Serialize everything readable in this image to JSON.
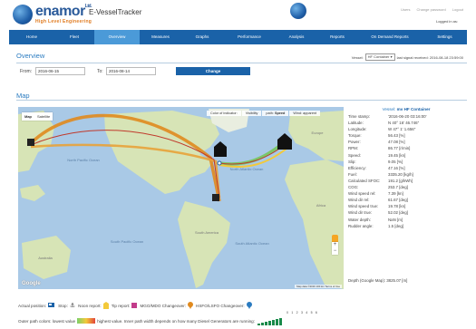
{
  "header": {
    "logo_name": "enamor",
    "logo_sup": "Ltd.",
    "logo_tagline": "High Level Engineering",
    "app_title": "E-VesselTracker",
    "top_links": [
      "Users",
      "Change password",
      "Logout"
    ],
    "logged_in": "Logged in as:"
  },
  "nav": {
    "items": [
      "Home",
      "Fleet",
      "Overview",
      "Measures",
      "Graphs",
      "Performance",
      "Analysis",
      "Reports",
      "On Demand Reports",
      "Settings"
    ],
    "active": "Overview"
  },
  "overview": {
    "title": "Overview",
    "vessel_label": "Vessel:",
    "vessel_value": "HF Container",
    "last_signal": "last signal received: 2016-08-18 23:59:00",
    "from_label": "From:",
    "from_value": "2016-06-15",
    "to_label": "To:",
    "to_value": "2016-08-14",
    "change_button": "Change"
  },
  "map": {
    "title": "Map",
    "tabs": [
      "Map",
      "Satellite"
    ],
    "active_tab": "Map",
    "overlay_options": [
      "Color of indicator:",
      "Visibility",
      "path:",
      "Speed",
      "Wind: apparent"
    ],
    "google_logo": "Google",
    "attribution": "Map data ©2016   100 km   Terms of Use",
    "labels": [
      "North Pacific Ocean",
      "North Atlantic Ocean",
      "South Pacific Ocean",
      "South Atlantic Ocean",
      "Australia",
      "Africa",
      "South America",
      "Europe"
    ]
  },
  "vessel_info": {
    "title_prefix": "Vessel:",
    "title_name": "mv HF Container",
    "rows": [
      {
        "k": "Time stamp:",
        "v": "'2016-06-20 03:16:00'"
      },
      {
        "k": "Latitude:",
        "v": "N 40° 16' 46.746\""
      },
      {
        "k": "Longitude:",
        "v": "W 47° 1' 1.656\""
      },
      {
        "k": "Torque:",
        "v": "56.43 [%]"
      },
      {
        "k": "Power:",
        "v": "47.08 [%]"
      },
      {
        "k": "RPM:",
        "v": "86.77 [r/min]"
      },
      {
        "k": "Speed:",
        "v": "19.45 [kn]"
      },
      {
        "k": "Slip:",
        "v": "9.05 [%]"
      },
      {
        "k": "Efficiency:",
        "v": "47.16 [%]"
      },
      {
        "k": "Fuel:",
        "v": "3335.20 [kg/h]"
      },
      {
        "k": "Calculated SFOC:",
        "v": "191.2 [g/kWh]"
      },
      {
        "k": "COG:",
        "v": "253.7 [deg]"
      },
      {
        "k": "Wind speed rel:",
        "v": "7.39 [kn]"
      },
      {
        "k": "Wind dir rel:",
        "v": "61.67 [deg]"
      },
      {
        "k": "Wind speed true:",
        "v": "19.78 [kn]"
      },
      {
        "k": "Wind dir true:",
        "v": "52.02 [deg]"
      },
      {
        "k": "Water depth:",
        "v": "NaN [m]"
      },
      {
        "k": "Rudder angle:",
        "v": "1.5 [deg]"
      }
    ],
    "depth_google": "Depth (Google Map): 3825.07 [m]"
  },
  "legend": {
    "actual_position": "Actual position:",
    "stop": "Stop:",
    "noon_report": "Noon report:",
    "tip_report": "Tip report:",
    "mgo_changeover": "MGO/MDO Changeover:",
    "hsfo_changeover": "HSFO/LSFO Changeover:",
    "outer_path": "Outer path colors: lowest value",
    "highest": "highest value. Inner path width depends on how many Diesel Generators are running:",
    "gen_counts": "0 1 2 3 4 5 6"
  },
  "colors": {
    "nav": "#1a62a8",
    "nav_active": "#4b9ad8",
    "accent": "#2a7bc0",
    "ocean": "#a9c9e6",
    "land": "#d7e4b6",
    "route": "#e08a1e"
  }
}
